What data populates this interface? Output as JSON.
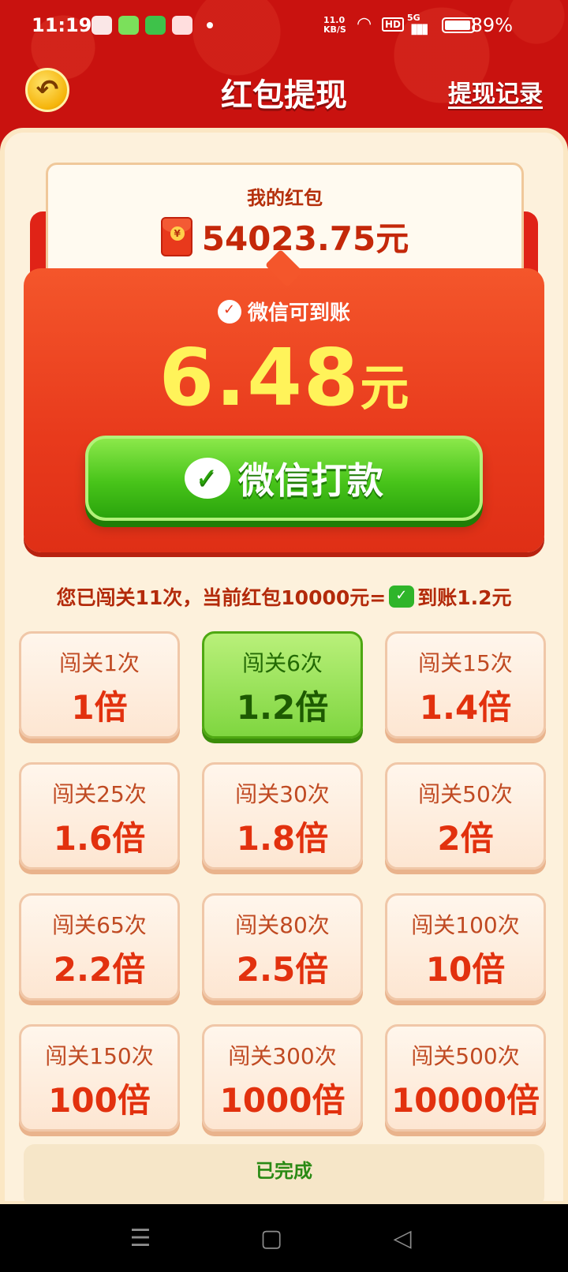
{
  "status_bar": {
    "time": "11:19",
    "speed": "11.0 KB/S",
    "hd": "HD",
    "network": "5G",
    "battery": "89%"
  },
  "header": {
    "title": "红包提现",
    "history_link": "提现记录",
    "back_icon": "undo-arrow-icon"
  },
  "wallet": {
    "label": "我的红包",
    "amount": "54023.75元"
  },
  "withdraw": {
    "tag": "微信可到账",
    "amount": "6.48",
    "unit": "元",
    "button_label": "微信打款"
  },
  "info": {
    "prefix": "您已闯关11次，当前红包10000元=",
    "suffix": "到账1.2元"
  },
  "tiers": [
    {
      "label": "闯关1次",
      "mult": "1倍"
    },
    {
      "label": "闯关6次",
      "mult": "1.2倍",
      "active": true
    },
    {
      "label": "闯关15次",
      "mult": "1.4倍"
    },
    {
      "label": "闯关25次",
      "mult": "1.6倍"
    },
    {
      "label": "闯关30次",
      "mult": "1.8倍"
    },
    {
      "label": "闯关50次",
      "mult": "2倍"
    },
    {
      "label": "闯关65次",
      "mult": "2.2倍"
    },
    {
      "label": "闯关80次",
      "mult": "2.5倍"
    },
    {
      "label": "闯关100次",
      "mult": "10倍"
    },
    {
      "label": "闯关150次",
      "mult": "100倍"
    },
    {
      "label": "闯关300次",
      "mult": "1000倍"
    },
    {
      "label": "闯关500次",
      "mult": "10000倍"
    }
  ],
  "footer": {
    "done_label": "已完成"
  },
  "colors": {
    "brand_red": "#c9120f",
    "accent_yellow": "#fff35a",
    "wechat_green": "#48c41a"
  }
}
